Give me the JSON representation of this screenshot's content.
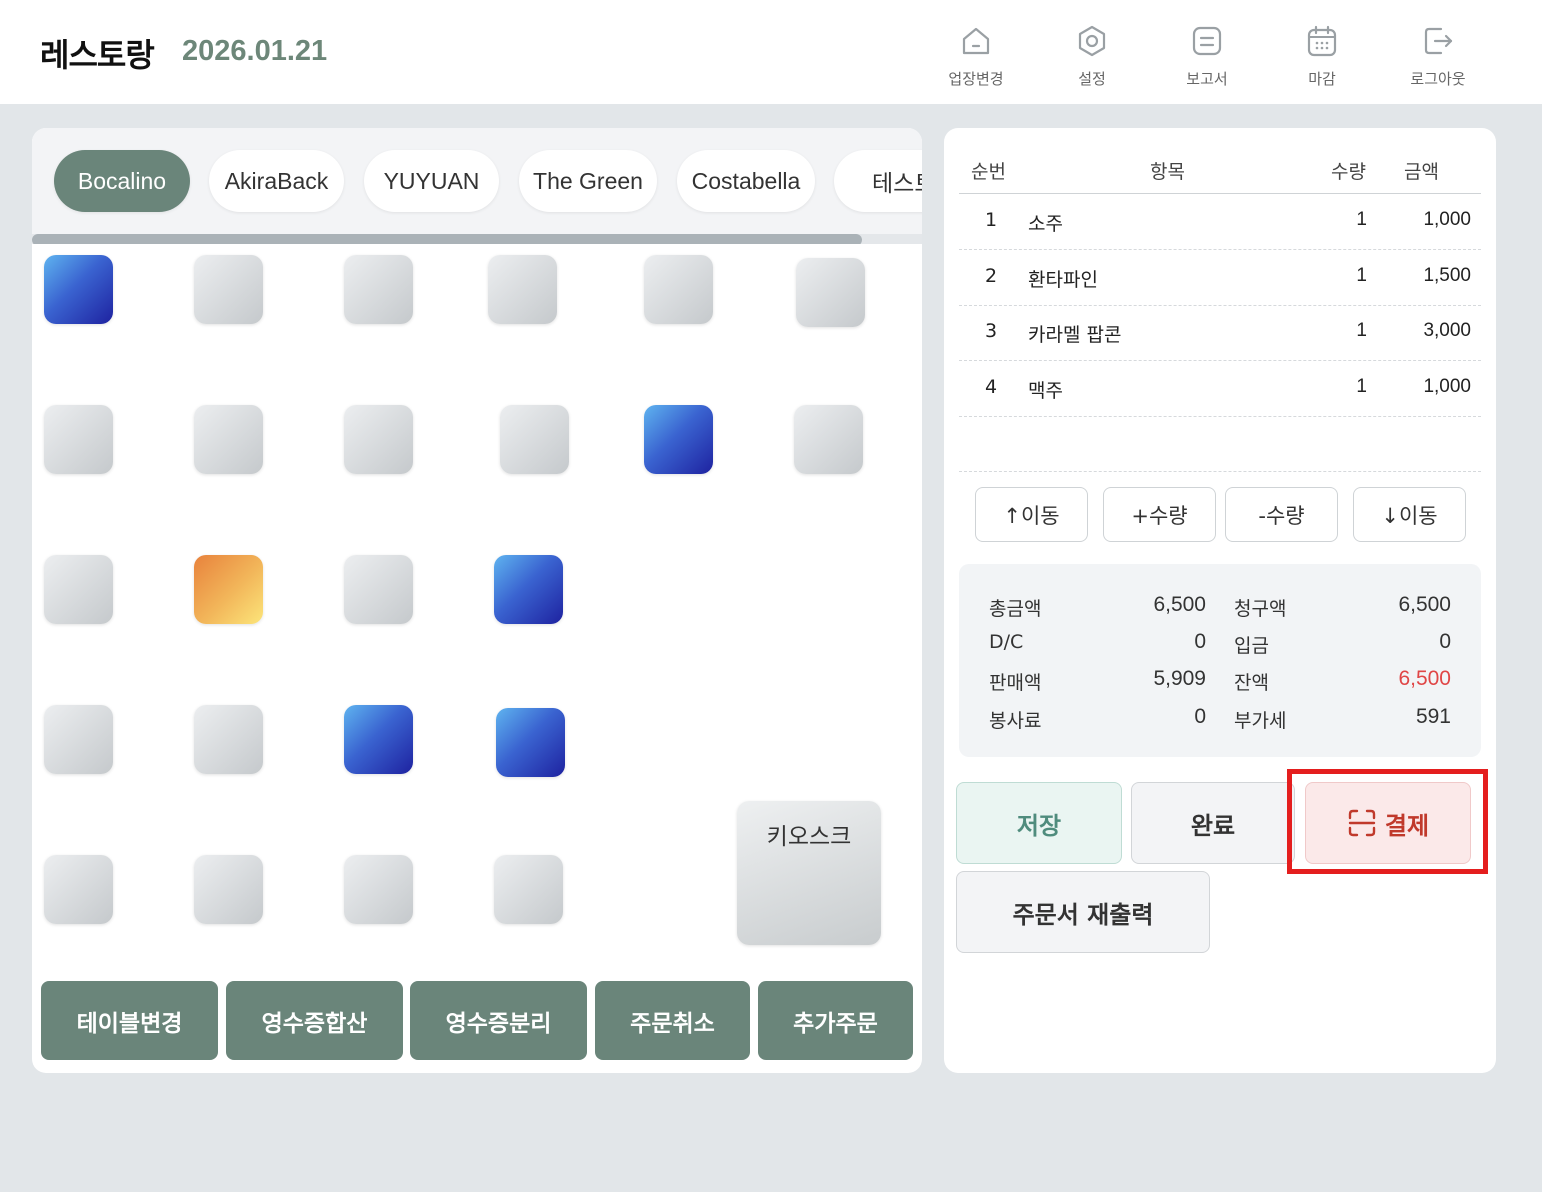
{
  "header": {
    "brand": "레스토랑",
    "date": "2026.01.21",
    "nav": [
      {
        "label": "업장변경",
        "icon": "home-icon"
      },
      {
        "label": "설정",
        "icon": "gear-icon"
      },
      {
        "label": "보고서",
        "icon": "report-icon"
      },
      {
        "label": "마감",
        "icon": "calendar-icon"
      },
      {
        "label": "로그아웃",
        "icon": "logout-icon"
      }
    ]
  },
  "store_tabs": [
    {
      "label": "Bocalino",
      "active": true
    },
    {
      "label": "AkiraBack",
      "active": false
    },
    {
      "label": "YUYUAN",
      "active": false
    },
    {
      "label": "The Green",
      "active": false
    },
    {
      "label": "Costabella",
      "active": false
    },
    {
      "label": "테스트",
      "active": false
    }
  ],
  "tables": {
    "rows": [
      [
        "blue",
        "gray",
        "gray",
        "gray",
        "gray",
        "gray"
      ],
      [
        "gray",
        "gray",
        "gray",
        "gray",
        "blue",
        "gray"
      ],
      [
        "gray",
        "orange",
        "gray",
        "blue"
      ],
      [
        "gray",
        "gray",
        "blue",
        "blue"
      ],
      [
        "gray",
        "gray",
        "gray",
        "gray"
      ]
    ],
    "kiosk_label": "키오스크"
  },
  "actions": [
    "테이블변경",
    "영수증합산",
    "영수증분리",
    "주문취소",
    "추가주문"
  ],
  "order": {
    "headers": {
      "no": "순번",
      "item": "항목",
      "qty": "수량",
      "amount": "금액"
    },
    "rows": [
      {
        "no": "1",
        "item": "소주",
        "qty": "1",
        "amount": "1,000"
      },
      {
        "no": "2",
        "item": "환타파인",
        "qty": "1",
        "amount": "1,500"
      },
      {
        "no": "3",
        "item": "카라멜 팝콘",
        "qty": "1",
        "amount": "3,000"
      },
      {
        "no": "4",
        "item": "맥주",
        "qty": "1",
        "amount": "1,000"
      }
    ],
    "controls": [
      "↑이동",
      "+수량",
      "-수량",
      "↓이동"
    ]
  },
  "summary": {
    "total_label": "총금액",
    "total": "6,500",
    "billed_label": "청구액",
    "billed": "6,500",
    "dc_label": "D/C",
    "dc": "0",
    "deposit_label": "입금",
    "deposit": "0",
    "sales_label": "판매액",
    "sales": "5,909",
    "balance_label": "잔액",
    "balance": "6,500",
    "service_label": "봉사료",
    "service": "0",
    "vat_label": "부가세",
    "vat": "591"
  },
  "buttons": {
    "save": "저장",
    "done": "완료",
    "pay": "결제",
    "reprint": "주문서 재출력"
  },
  "colors": {
    "accent": "#6a857a",
    "balance_red": "#e04646",
    "highlight": "#e41e1e"
  }
}
